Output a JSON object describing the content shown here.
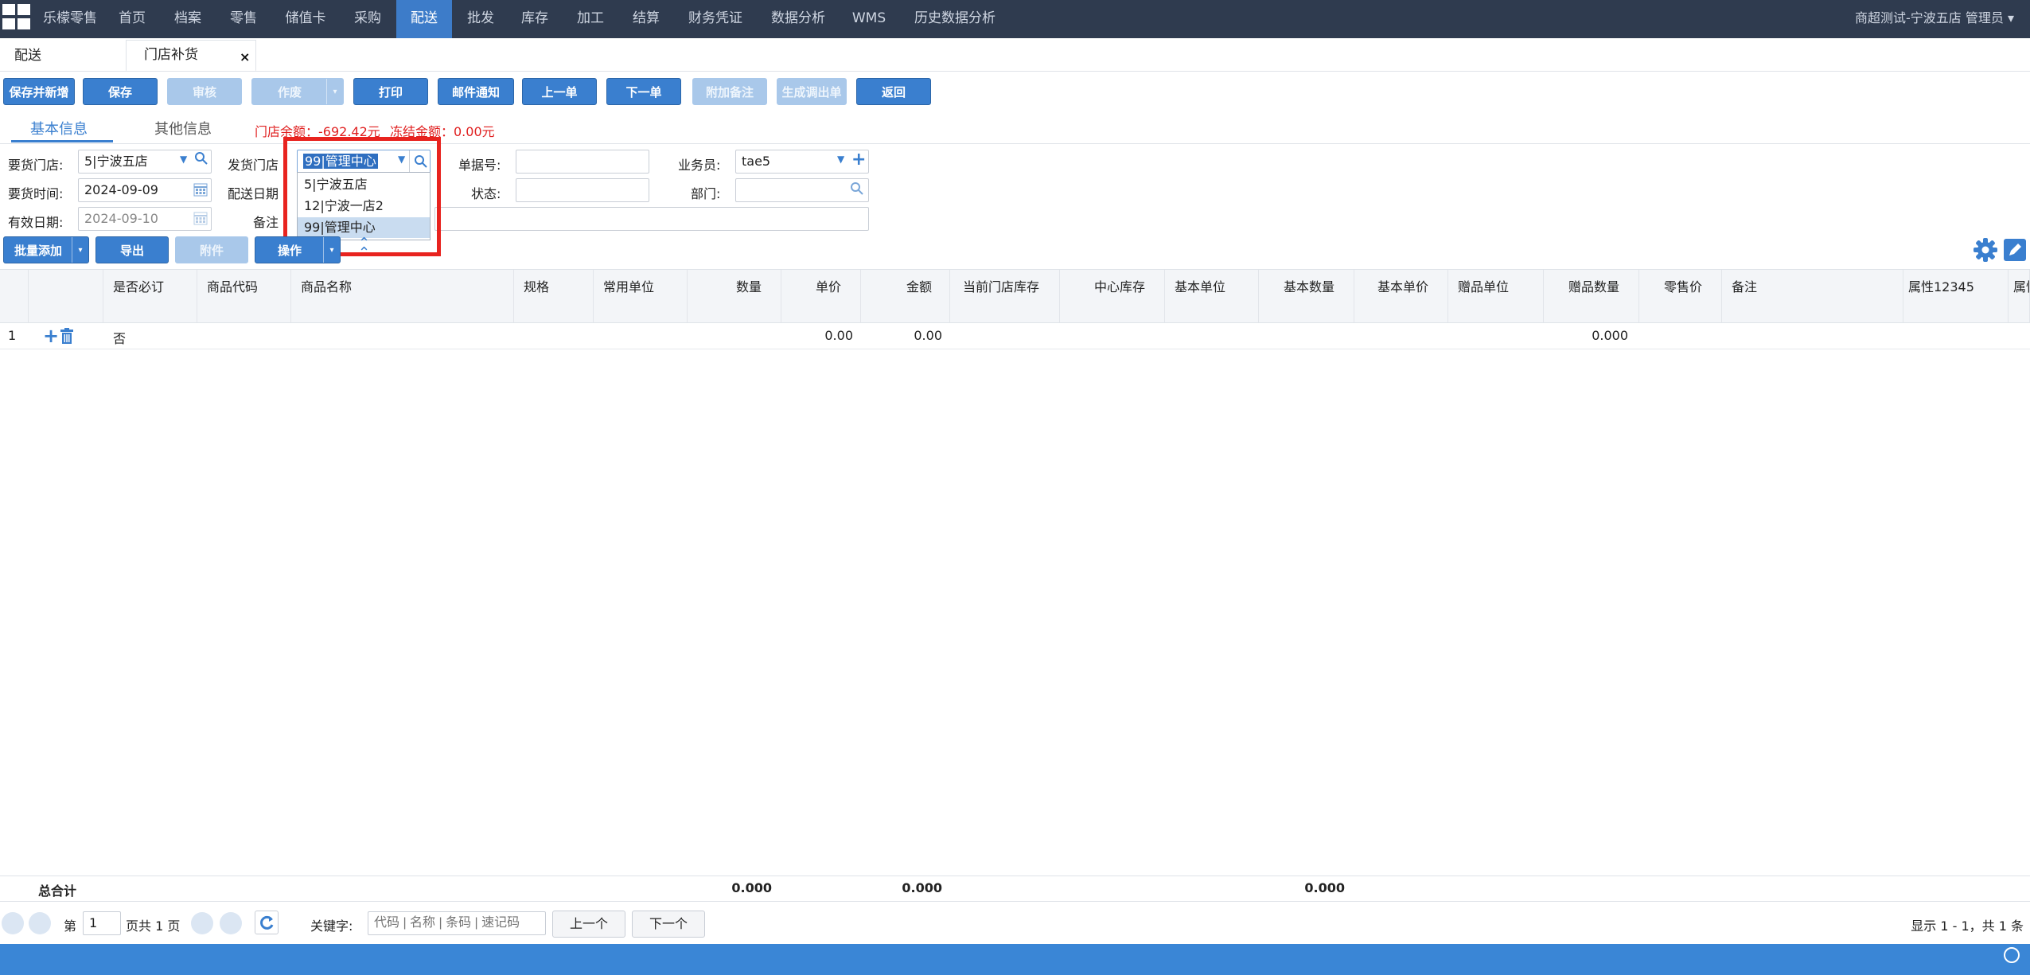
{
  "nav": {
    "brand": "乐檬零售",
    "items": [
      "首页",
      "档案",
      "零售",
      "储值卡",
      "采购",
      "配送",
      "批发",
      "库存",
      "加工",
      "结算",
      "财务凭证",
      "数据分析",
      "WMS",
      "历史数据分析"
    ],
    "active": "配送",
    "user": "商超测试-宁波五店 管理员 ▾"
  },
  "tabs": {
    "first": "配送",
    "second": "门店补货",
    "close": "×"
  },
  "toolbar": {
    "save_new": "保存并新增",
    "save": "保存",
    "audit": "审核",
    "void": "作废",
    "print": "打印",
    "mail": "邮件通知",
    "prev": "上一单",
    "next": "下一单",
    "attach_note": "附加备注",
    "gen_out": "生成调出单",
    "back": "返回"
  },
  "subtabs": {
    "basic": "基本信息",
    "other": "其他信息"
  },
  "balance": {
    "store": "门店余额：-692.42元",
    "frozen": "冻结金额：0.00元"
  },
  "form": {
    "req_store_label": "要货门店:",
    "req_store": "5|宁波五店",
    "send_store_label": "发货门店",
    "send_store": "99|管理中心",
    "doc_no_label": "单据号:",
    "doc_no": "",
    "salesman_label": "业务员:",
    "salesman": "tae5",
    "req_time_label": "要货时间:",
    "req_time": "2024-09-09",
    "ship_date_label": "配送日期",
    "status_label": "状态:",
    "status": "",
    "dept_label": "部门:",
    "dept": "",
    "valid_date_label": "有效日期:",
    "valid_date": "2024-09-10",
    "note_label": "备注"
  },
  "dropdown": {
    "options": [
      "5|宁波五店",
      "12|宁波一店2",
      "99|管理中心"
    ],
    "selected": "99|管理中心"
  },
  "grid_toolbar": {
    "batch_add": "批量添加",
    "export": "导出",
    "attachment": "附件",
    "operate": "操作"
  },
  "table": {
    "headers": [
      "是否必订",
      "商品代码",
      "商品名称",
      "规格",
      "常用单位",
      "数量",
      "单价",
      "金额",
      "当前门店库存",
      "中心库存",
      "基本单位",
      "基本数量",
      "基本单价",
      "赠品单位",
      "赠品数量",
      "零售价",
      "备注",
      "属性12345",
      "属性"
    ],
    "rows": [
      {
        "no": "1",
        "required": "否",
        "price": "0.00",
        "amount": "0.00",
        "gift_qty": "0.000"
      }
    ],
    "total_label": "总合计",
    "total_qty": "0.000",
    "total_amount": "0.000",
    "total_basic_qty": "0.000"
  },
  "pager": {
    "page_prefix": "第",
    "page": "1",
    "page_suffix": "页共 1 页",
    "keyword_label": "关键字:",
    "keyword_placeholder": "代码 | 名称 | 条码 | 速记码",
    "prev": "上一个",
    "next": "下一个",
    "summary": "显示 1 - 1，共 1 条"
  }
}
